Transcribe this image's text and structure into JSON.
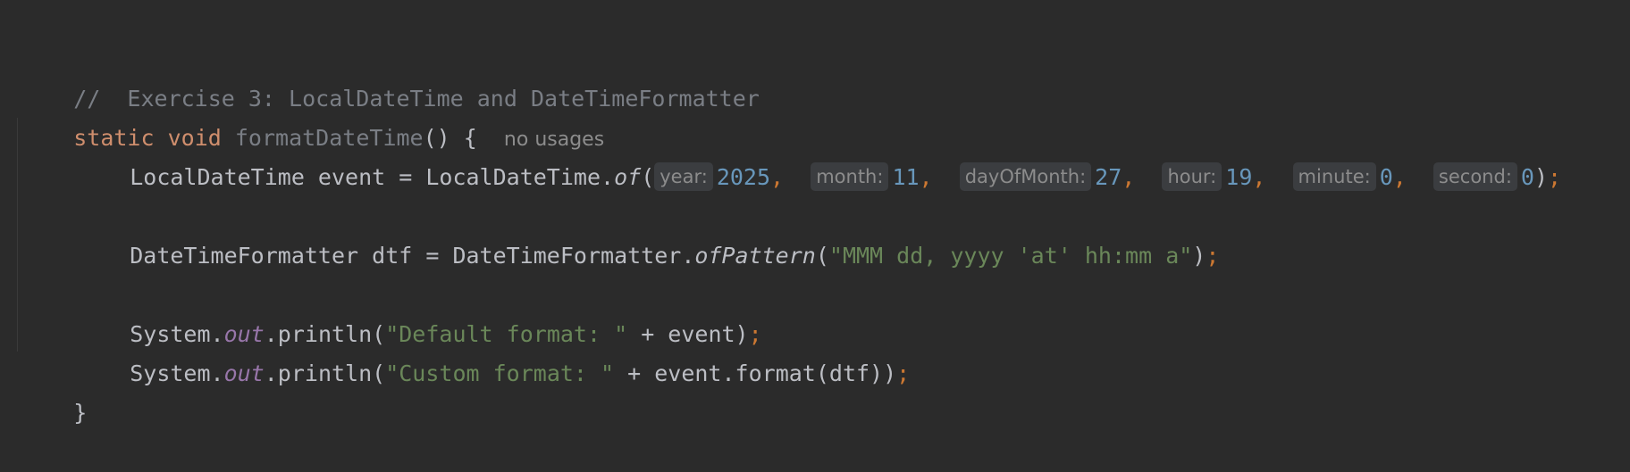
{
  "code": {
    "comment": "//  Exercise 3: LocalDateTime and DateTimeFormatter",
    "decl_static": "static",
    "decl_void": "void",
    "decl_name": "formatDateTime",
    "decl_paren_brace": "() {",
    "usages": "no usages",
    "l3_a": "LocalDateTime event = LocalDateTime.",
    "l3_of": "of",
    "l3_open": "(",
    "hint_year": "year:",
    "val_year": "2025",
    "hint_month": "month:",
    "val_month": "11",
    "hint_day": "dayOfMonth:",
    "val_day": "27",
    "hint_hour": "hour:",
    "val_hour": "19",
    "hint_minute": "minute:",
    "val_minute": "0",
    "hint_second": "second:",
    "val_second": "0",
    "comma": ",",
    "close_paren": ")",
    "semicolon": ";",
    "l5_a": "DateTimeFormatter dtf = DateTimeFormatter.",
    "l5_method": "ofPattern",
    "l5_open": "(",
    "l5_str": "\"MMM dd, yyyy 'at' hh:mm a\"",
    "l5_close": ")",
    "sys": "System.",
    "out": "out",
    "println": ".println(",
    "l7_str": "\"Default format: \"",
    "l7_rest": " + event)",
    "l8_str": "\"Custom format: \"",
    "l8_rest": " + event.format(dtf))",
    "closing_brace": "}"
  }
}
